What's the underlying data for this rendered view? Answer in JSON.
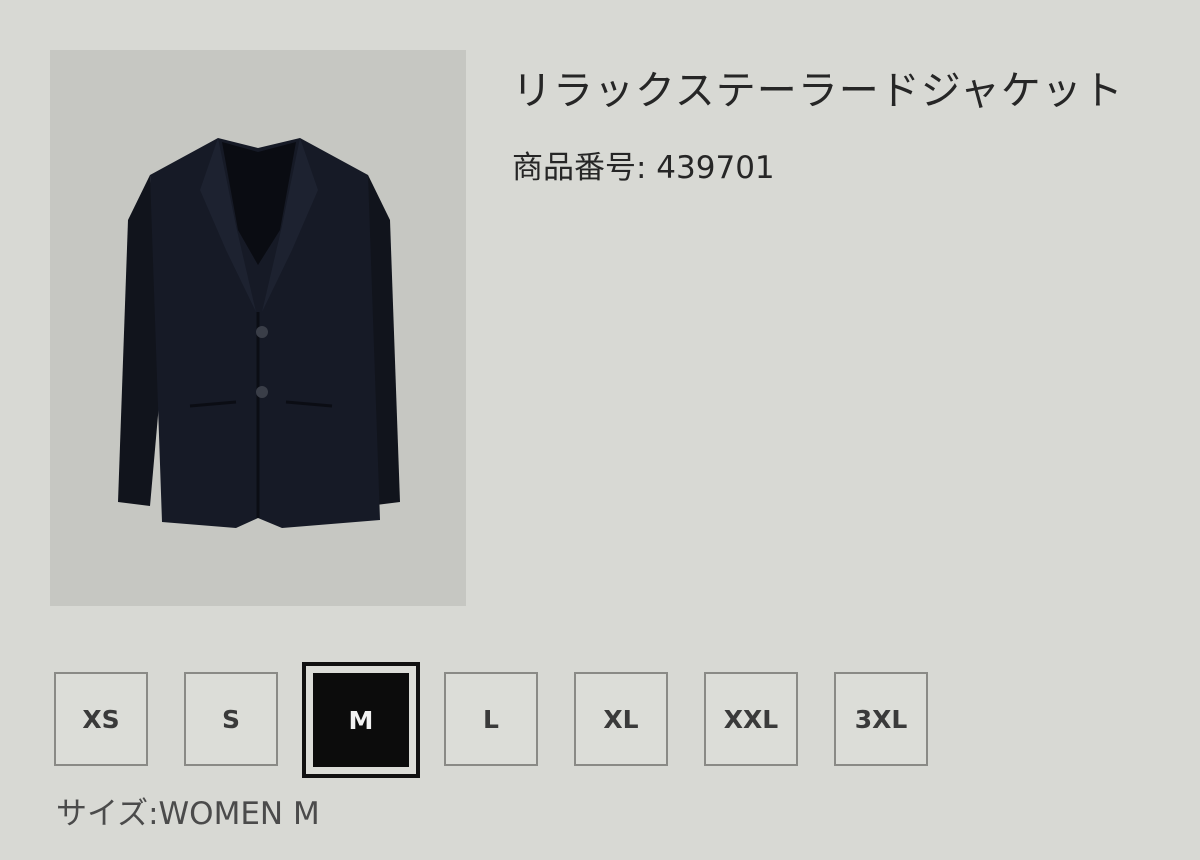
{
  "product": {
    "title": "リラックステーラードジャケット",
    "number_label": "商品番号: 439701",
    "image": "navy tailored jacket"
  },
  "sizes": {
    "options": [
      "XS",
      "S",
      "M",
      "L",
      "XL",
      "XXL",
      "3XL"
    ],
    "selected": "M"
  },
  "size_status": "サイズ:WOMEN M",
  "colors": {
    "background": "#d8d9d4",
    "jacket": "#141823",
    "selected_fill": "#0c0c0c"
  }
}
